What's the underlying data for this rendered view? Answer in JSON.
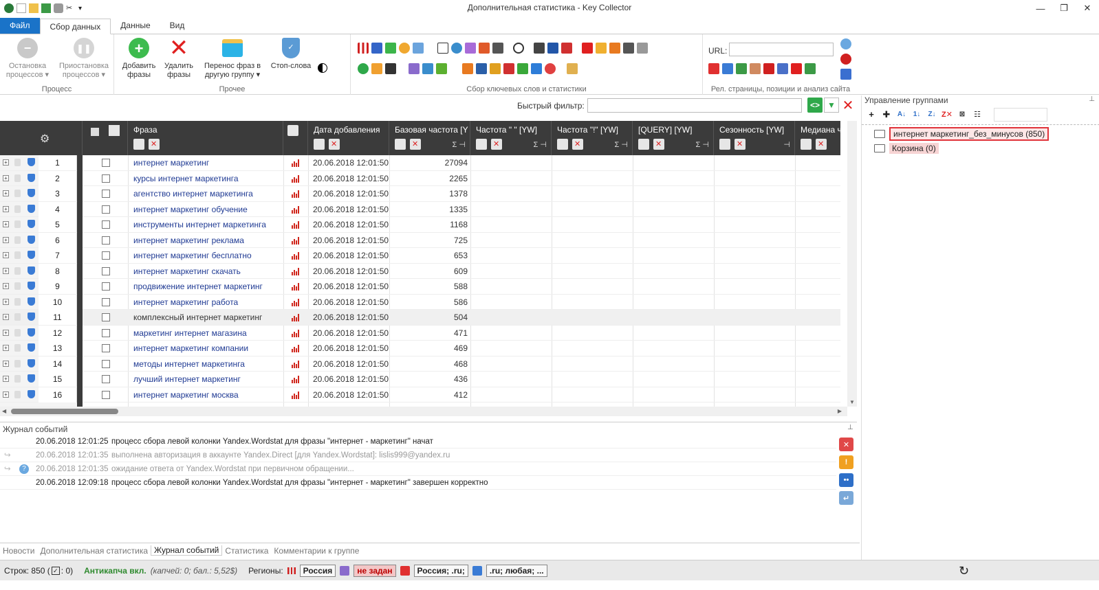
{
  "window": {
    "title": "Дополнительная статистика - Key Collector",
    "controls": [
      "—",
      "❐",
      "✕"
    ]
  },
  "ribbon_tabs": [
    {
      "label": "Файл"
    },
    {
      "label": "Сбор данных"
    },
    {
      "label": "Данные"
    },
    {
      "label": "Вид"
    }
  ],
  "ribbon": {
    "process": {
      "label": "Процесс",
      "stop_label": "Остановка процессов ▾",
      "pause_label": "Приостановка процессов ▾"
    },
    "misc": {
      "label": "Прочее",
      "add_label": "Добавить фразы",
      "delete_label": "Удалить фразы",
      "move_label": "Перенос фраз в другую группу ▾",
      "stopwords_label": "Стоп-слова"
    },
    "collect": {
      "label": "Сбор ключевых слов и статистики"
    },
    "rel": {
      "label": "Рел. страницы, позиции и анализ сайта",
      "url_label": "URL:"
    }
  },
  "filter": {
    "label": "Быстрый фильтр:",
    "value": ""
  },
  "grid": {
    "columns": [
      "Фраза",
      "Дата добавления",
      "Базовая частота [Y",
      "Частота \" \" [YW]",
      "Частота \"!\" [YW]",
      "[QUERY] [YW]",
      "Сезонность [YW]",
      "Медиана ч"
    ],
    "rows": [
      {
        "n": "1",
        "phrase": "интернет маркетинг",
        "date": "20.06.2018 12:01:50",
        "freq": "27094"
      },
      {
        "n": "2",
        "phrase": "курсы интернет маркетинга",
        "date": "20.06.2018 12:01:50",
        "freq": "2265"
      },
      {
        "n": "3",
        "phrase": "агентство интернет маркетинга",
        "date": "20.06.2018 12:01:50",
        "freq": "1378"
      },
      {
        "n": "4",
        "phrase": "интернет маркетинг обучение",
        "date": "20.06.2018 12:01:50",
        "freq": "1335"
      },
      {
        "n": "5",
        "phrase": "инструменты интернет маркетинга",
        "date": "20.06.2018 12:01:50",
        "freq": "1168"
      },
      {
        "n": "6",
        "phrase": "интернет маркетинг реклама",
        "date": "20.06.2018 12:01:50",
        "freq": "725"
      },
      {
        "n": "7",
        "phrase": "интернет маркетинг бесплатно",
        "date": "20.06.2018 12:01:50",
        "freq": "653"
      },
      {
        "n": "8",
        "phrase": "интернет маркетинг скачать",
        "date": "20.06.2018 12:01:50",
        "freq": "609"
      },
      {
        "n": "9",
        "phrase": "продвижение интернет маркетинг",
        "date": "20.06.2018 12:01:50",
        "freq": "588"
      },
      {
        "n": "10",
        "phrase": "интернет маркетинг работа",
        "date": "20.06.2018 12:01:50",
        "freq": "586"
      },
      {
        "n": "11",
        "phrase": "комплексный интернет маркетинг",
        "date": "20.06.2018 12:01:50",
        "freq": "504"
      },
      {
        "n": "12",
        "phrase": "маркетинг интернет магазина",
        "date": "20.06.2018 12:01:50",
        "freq": "471"
      },
      {
        "n": "13",
        "phrase": "интернет маркетинг компании",
        "date": "20.06.2018 12:01:50",
        "freq": "469"
      },
      {
        "n": "14",
        "phrase": "методы интернет маркетинга",
        "date": "20.06.2018 12:01:50",
        "freq": "468"
      },
      {
        "n": "15",
        "phrase": "лучший интернет маркетинг",
        "date": "20.06.2018 12:01:50",
        "freq": "436"
      },
      {
        "n": "16",
        "phrase": "интернет маркетинг москва",
        "date": "20.06.2018 12:01:50",
        "freq": "412"
      }
    ]
  },
  "log": {
    "title": "Журнал событий",
    "entries": [
      {
        "time": "20.06.2018 12:01:25",
        "msg": "процесс сбора левой колонки Yandex.Wordstat для фразы \"интернет - маркетинг\" начат"
      },
      {
        "time": "20.06.2018 12:01:35",
        "msg": "выполнена авторизация в аккаунте Yandex.Direct [для Yandex.Wordstat]: lislis999@yandex.ru"
      },
      {
        "time": "20.06.2018 12:01:35",
        "msg": "ожидание ответа от Yandex.Wordstat при первичном обращении..."
      },
      {
        "time": "20.06.2018 12:09:18",
        "msg": "процесс сбора левой колонки Yandex.Wordstat для фразы \"интернет - маркетинг\" завершен корректно"
      }
    ]
  },
  "bottom_tabs": [
    "Новости",
    "Дополнительная статистика",
    "Журнал событий",
    "Статистика",
    "Комментарии к группе"
  ],
  "groups": {
    "title": "Управление группами",
    "items": [
      {
        "label": "интернет маркетинг_без_минусов (850)"
      },
      {
        "label": "Корзина (0)"
      }
    ]
  },
  "status": {
    "rows": "Строк: 850 (",
    "rows_checked": ": 0)",
    "anticaptcha": "Антикапча вкл.",
    "captcha_info": "(капчей: 0; бал.: 5,52$)",
    "regions_label": "Регионы:",
    "region_1": "Россия",
    "region_2": "не задан",
    "region_3": "Россия; .ru;",
    "region_4": ".ru; любая; ..."
  }
}
